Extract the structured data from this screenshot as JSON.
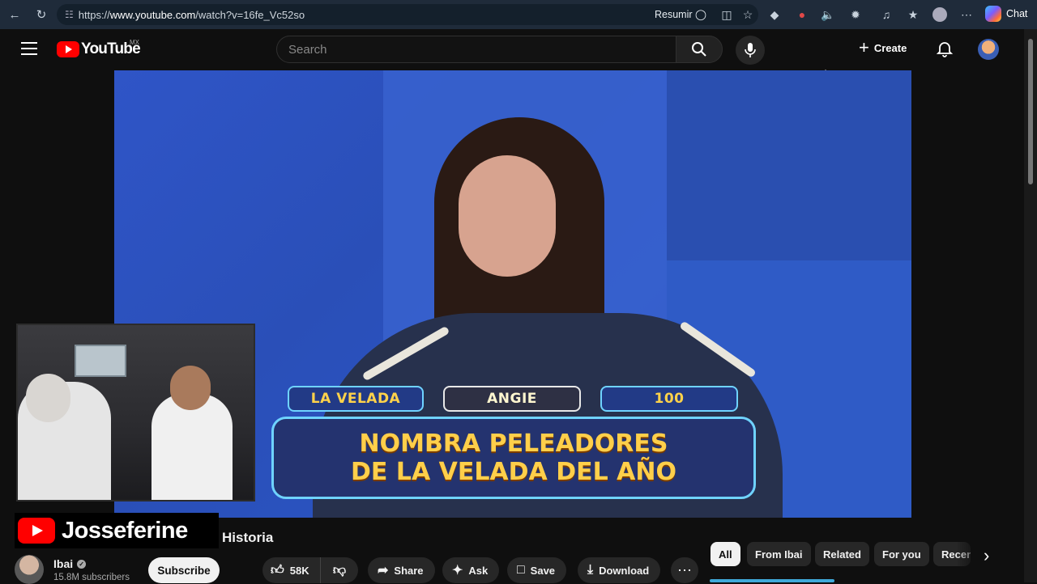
{
  "browser": {
    "url_prefix": "https://",
    "url_host": "www.youtube.com",
    "url_path": "/watch?v=16fe_Vc52so",
    "summarize_label": "Resumir",
    "chat_label": "Chat"
  },
  "masthead": {
    "logo_text": "YouTube",
    "country_code": "MX",
    "search_placeholder": "Search",
    "create_label": "Create"
  },
  "video": {
    "overlay_left": "LA VELADA",
    "overlay_mid": "ANGIE",
    "overlay_right": "100",
    "question_line1": "NOMBRA PELEADORES",
    "question_line2": "DE LA VELADA DEL AÑO"
  },
  "streamer_brand": "Josseferine",
  "watch": {
    "title": "Historia",
    "channel_name": "Ibai",
    "subscribers": "15.8M subscribers",
    "subscribe_label": "Subscribe",
    "like_count": "58K",
    "share_label": "Share",
    "ask_label": "Ask",
    "save_label": "Save",
    "download_label": "Download"
  },
  "chips": [
    "All",
    "From Ibai",
    "Related",
    "For you",
    "Recen"
  ]
}
